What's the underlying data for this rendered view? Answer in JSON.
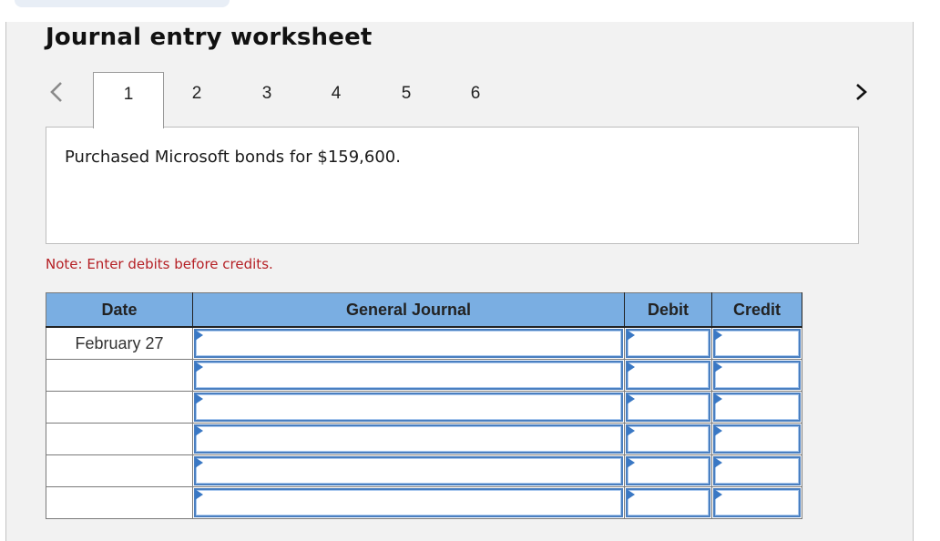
{
  "title": "Journal entry worksheet",
  "navigation": {
    "prev_icon": "chevron-left-icon",
    "next_icon": "chevron-right-icon",
    "tabs": [
      {
        "label": "1",
        "active": true
      },
      {
        "label": "2",
        "active": false
      },
      {
        "label": "3",
        "active": false
      },
      {
        "label": "4",
        "active": false
      },
      {
        "label": "5",
        "active": false
      },
      {
        "label": "6",
        "active": false
      }
    ]
  },
  "description": "Purchased Microsoft bonds for $159,600.",
  "note": "Note: Enter debits before credits.",
  "colors": {
    "header_bg": "#7aaee2",
    "note_red": "#b52025",
    "input_border": "#4a7fc0"
  },
  "journal": {
    "headers": {
      "date": "Date",
      "general_journal": "General Journal",
      "debit": "Debit",
      "credit": "Credit"
    },
    "rows": [
      {
        "date": "February 27",
        "account": "",
        "debit": "",
        "credit": ""
      },
      {
        "date": "",
        "account": "",
        "debit": "",
        "credit": ""
      },
      {
        "date": "",
        "account": "",
        "debit": "",
        "credit": ""
      },
      {
        "date": "",
        "account": "",
        "debit": "",
        "credit": ""
      },
      {
        "date": "",
        "account": "",
        "debit": "",
        "credit": ""
      },
      {
        "date": "",
        "account": "",
        "debit": "",
        "credit": ""
      }
    ]
  }
}
